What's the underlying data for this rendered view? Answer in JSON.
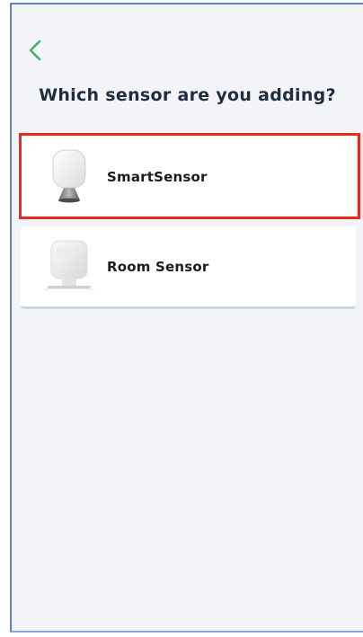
{
  "header": {
    "back_icon": "chevron-left-icon",
    "title": "Which sensor are you adding?"
  },
  "options": [
    {
      "label": "SmartSensor",
      "icon": "smartsensor-device-icon",
      "selected": true
    },
    {
      "label": "Room Sensor",
      "icon": "room-sensor-device-icon",
      "selected": false
    }
  ],
  "colors": {
    "accent": "#4caf6a",
    "highlight": "#ee2b1a",
    "background": "#f3f4f8",
    "text": "#1f2d3d"
  }
}
